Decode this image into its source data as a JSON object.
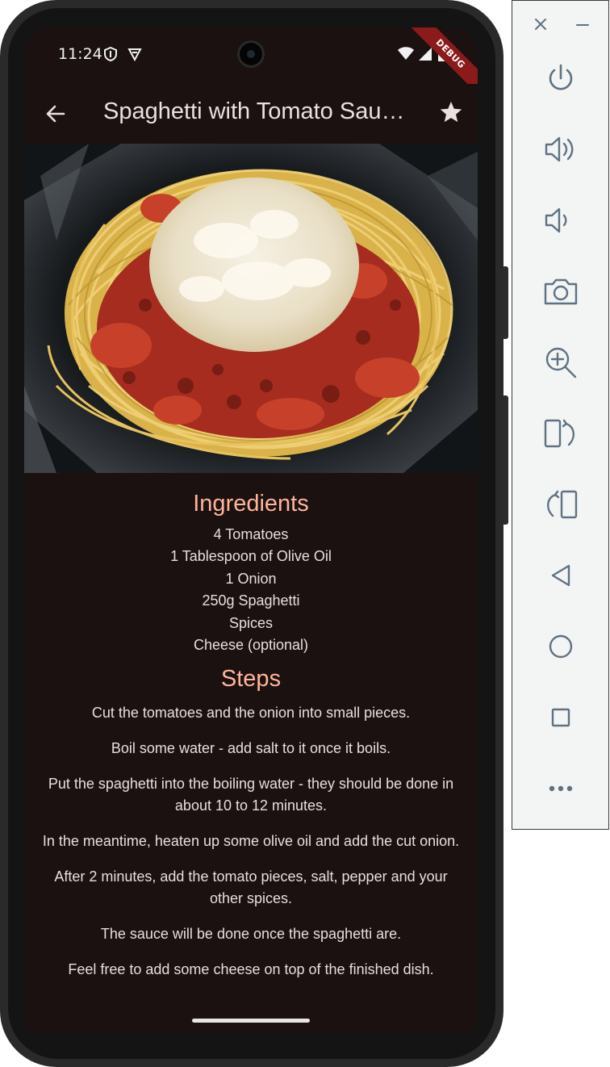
{
  "status_bar": {
    "time": "11:24",
    "debug_label": "DEBUG"
  },
  "app_bar": {
    "title": "Spaghetti with Tomato Sau…",
    "back_icon": "arrow-back-icon",
    "favorite_icon": "star-icon"
  },
  "ingredients": {
    "heading": "Ingredients",
    "items": [
      "4 Tomatoes",
      "1 Tablespoon of Olive Oil",
      "1 Onion",
      "250g Spaghetti",
      "Spices",
      "Cheese (optional)"
    ]
  },
  "steps": {
    "heading": "Steps",
    "items": [
      "Cut the tomatoes and the onion into small pieces.",
      "Boil some water - add salt to it once it boils.",
      "Put the spaghetti into the boiling water - they should be done in about 10 to 12 minutes.",
      "In the meantime, heaten up some olive oil and add the cut onion.",
      "After 2 minutes, add the tomato pieces, salt, pepper and your other spices.",
      "The sauce will be done once the spaghetti are.",
      "Feel free to add some cheese on top of the finished dish."
    ]
  },
  "colors": {
    "background": "#1a1110",
    "heading": "#ffb59a",
    "text": "#eadedb",
    "debug_banner": "#8b1a1a"
  },
  "emulator_panel": {
    "buttons": [
      "close-icon",
      "minimize-icon",
      "power-icon",
      "volume-up-icon",
      "volume-down-icon",
      "camera-icon",
      "zoom-in-icon",
      "rotate-left-icon",
      "rotate-right-icon",
      "back-icon",
      "home-icon",
      "overview-icon",
      "more-icon"
    ]
  }
}
